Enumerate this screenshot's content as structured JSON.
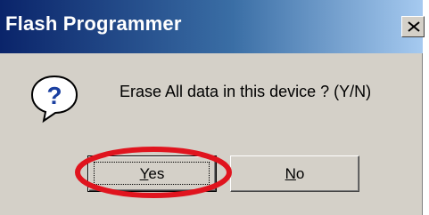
{
  "dialog": {
    "title": "Flash Programmer",
    "message": "Erase All data in this device ? (Y/N)",
    "icon": "question-icon",
    "close_icon": "close-icon"
  },
  "buttons": {
    "yes": {
      "mnemonic": "Y",
      "rest": "es"
    },
    "no": {
      "mnemonic": "N",
      "rest": "o"
    }
  },
  "annotation": {
    "highlight_color": "#e0141e",
    "target": "yes-button"
  },
  "colors": {
    "titlebar_start": "#0a246a",
    "titlebar_end": "#a6caf0",
    "dialog_bg": "#d4d0c8",
    "icon_blue": "#1a3fa0"
  }
}
